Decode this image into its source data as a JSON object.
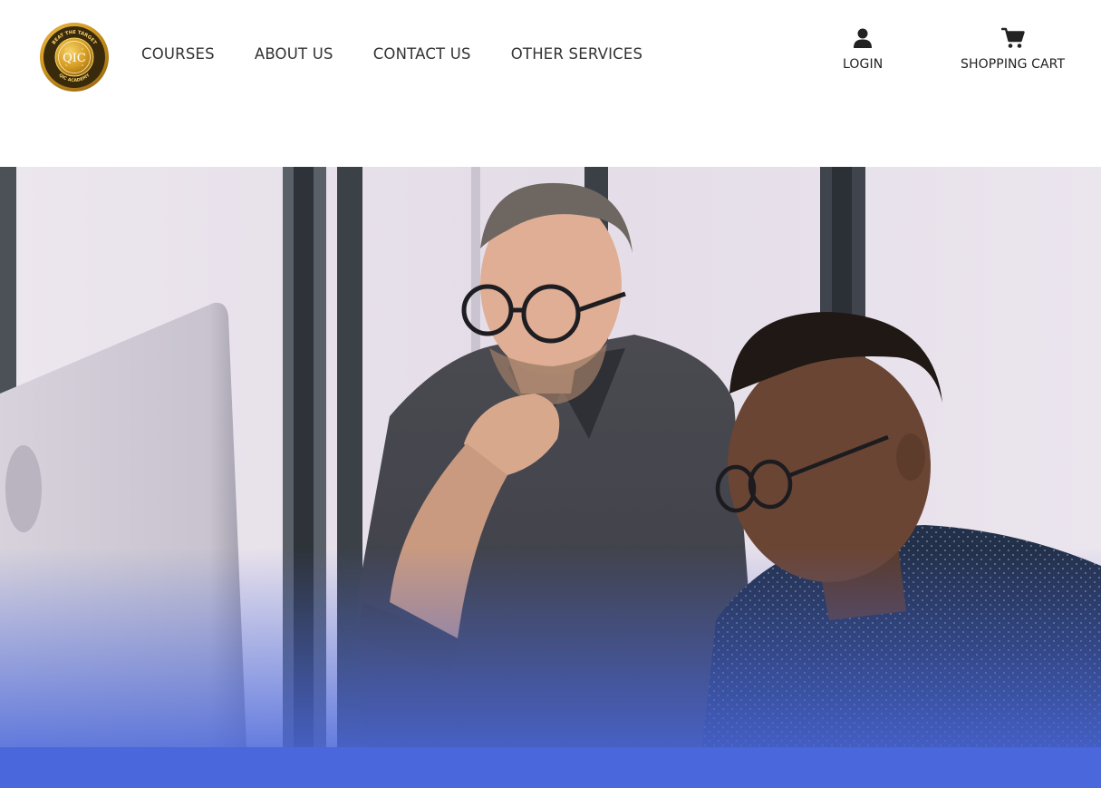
{
  "logo": {
    "text": "QIC",
    "ring_top": "BEAT THE TARGET",
    "ring_bottom": "QIC ACADEMY"
  },
  "nav": {
    "items": [
      "COURSES",
      "ABOUT US",
      "CONTACT US",
      "OTHER SERVICES"
    ]
  },
  "user_menu": {
    "login_label": "LOGIN",
    "login_icon": "user-icon",
    "cart_label": "SHOPPING CART",
    "cart_icon": "cart-icon"
  },
  "hero": {
    "image_description_icon": "hero-photo",
    "overlay_color": "#4a68dc"
  },
  "colors": {
    "logo_gold": "#c9961f",
    "logo_dark": "#3a2a0c",
    "nav_text": "#333333",
    "accent_blue": "#4a68dc"
  }
}
